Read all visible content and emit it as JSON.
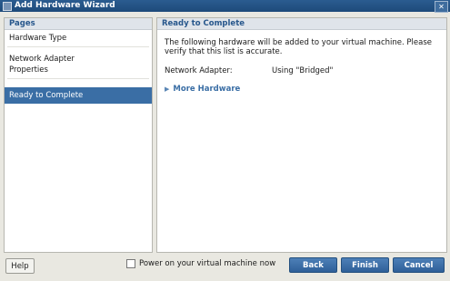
{
  "window": {
    "title": "Add Hardware Wizard"
  },
  "sidebar": {
    "heading": "Pages",
    "items": [
      {
        "label": "Hardware Type"
      },
      {
        "label": "Network Adapter\nProperties"
      },
      {
        "label": "Ready to Complete",
        "selected": true
      }
    ]
  },
  "main": {
    "heading": "Ready to Complete",
    "intro": "The following hardware will be added to your virtual machine. Please verify that this list is accurate.",
    "adapter_label": "Network Adapter:",
    "adapter_value": "Using \"Bridged\"",
    "more_hardware": "More Hardware"
  },
  "footer": {
    "help_label": "Help",
    "power_checkbox_label": "Power on your virtual machine now",
    "power_checked": false,
    "back_label": "Back",
    "finish_label": "Finish",
    "cancel_label": "Cancel"
  },
  "colors": {
    "titlebar": "#1e4a7a",
    "accent": "#3a6ea5",
    "selected_item": "#3a6ea5",
    "panel_header_bg": "#dfe4ea"
  },
  "icons": {
    "title_icon": "app-icon",
    "close_icon": "close-icon",
    "more_arrow": "triangle-right-icon"
  }
}
